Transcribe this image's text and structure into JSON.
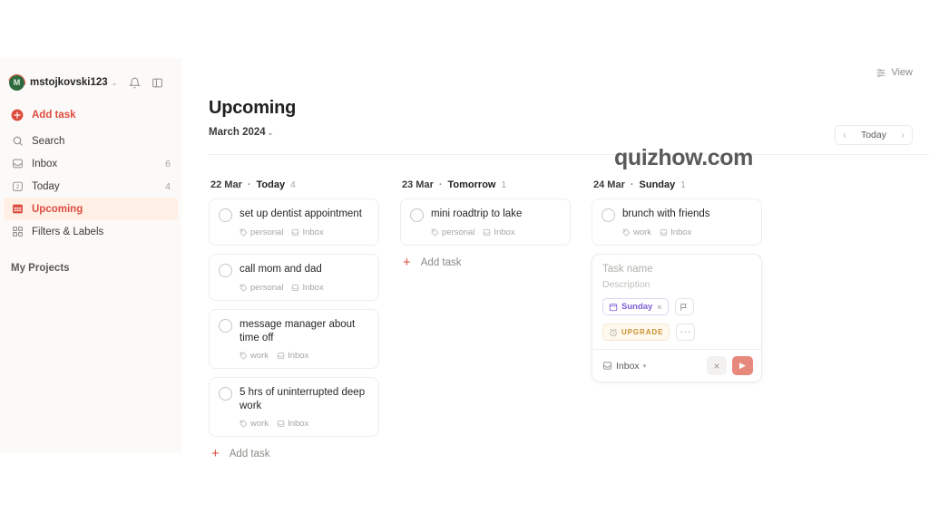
{
  "watermark": "quizhow.com",
  "sidebar": {
    "account": {
      "username": "mstojkovski123",
      "avatar_initial": "M",
      "chevron": "⌄"
    },
    "top_icons": [
      {
        "name": "notifications-bell-icon"
      },
      {
        "name": "toggle-sidebar-icon"
      }
    ],
    "items": [
      {
        "label": "Add task",
        "icon": "plus-circle-icon",
        "count": "",
        "state": "accent"
      },
      {
        "label": "Search",
        "icon": "search-icon",
        "count": "",
        "state": "normal"
      },
      {
        "label": "Inbox",
        "icon": "inbox-icon",
        "count": "6",
        "state": "normal"
      },
      {
        "label": "Today",
        "icon": "calendar-today-icon",
        "count": "4",
        "state": "normal"
      },
      {
        "label": "Upcoming",
        "icon": "calendar-grid-icon",
        "count": "",
        "state": "active"
      },
      {
        "label": "Filters & Labels",
        "icon": "filters-labels-icon",
        "count": "",
        "state": "normal"
      }
    ],
    "projects_header": "My Projects"
  },
  "header": {
    "view_label": "View",
    "view_icon": "sliders-icon",
    "title": "Upcoming",
    "month": "March 2024",
    "month_chevron": "⌄",
    "nav": {
      "prev": "‹",
      "today": "Today",
      "next": "›"
    }
  },
  "columns": [
    {
      "date": "22 Mar",
      "separator": "·",
      "day": "Today",
      "count": "4",
      "tasks": [
        {
          "title": "set up dentist appointment",
          "label": "personal",
          "project": "Inbox"
        },
        {
          "title": "call mom and dad",
          "label": "personal",
          "project": "Inbox"
        },
        {
          "title": "message manager about time off",
          "label": "work",
          "project": "Inbox"
        },
        {
          "title": "5 hrs of uninterrupted deep work",
          "label": "work",
          "project": "Inbox"
        }
      ],
      "add_task": "Add task",
      "show_add": true,
      "editor": null
    },
    {
      "date": "23 Mar",
      "separator": "·",
      "day": "Tomorrow",
      "count": "1",
      "tasks": [
        {
          "title": "mini roadtrip to lake",
          "label": "personal",
          "project": "Inbox"
        }
      ],
      "add_task": "Add task",
      "show_add": true,
      "editor": null
    },
    {
      "date": "24 Mar",
      "separator": "·",
      "day": "Sunday",
      "count": "1",
      "tasks": [
        {
          "title": "brunch with friends",
          "label": "work",
          "project": "Inbox"
        }
      ],
      "add_task": "",
      "show_add": false,
      "editor": {
        "name_placeholder": "Task name",
        "description_placeholder": "Description",
        "date_chip": {
          "label": "Sunday",
          "icon": "calendar-icon",
          "remove": "×"
        },
        "priority_chip": {
          "icon": "flag-icon"
        },
        "reminder_chip": {
          "icon": "alarm-clock-icon",
          "badge": "UPGRADE"
        },
        "more_chip": {
          "icon": "more-horizontal-icon",
          "glyph": "···"
        },
        "project_select": {
          "label": "Inbox",
          "icon": "inbox-icon",
          "chevron": "▾"
        },
        "cancel": {
          "icon": "close-icon",
          "glyph": "×"
        },
        "submit": {
          "icon": "send-icon",
          "glyph": "▶"
        }
      }
    }
  ],
  "colors": {
    "accent_red": "#dc4c3e",
    "active_bg": "#ffefe5",
    "sidebar_bg": "#fcfaf8",
    "purple_date": "#7b5ed6",
    "upgrade_gold": "#c88f2e",
    "send_button": "#e8897e"
  }
}
